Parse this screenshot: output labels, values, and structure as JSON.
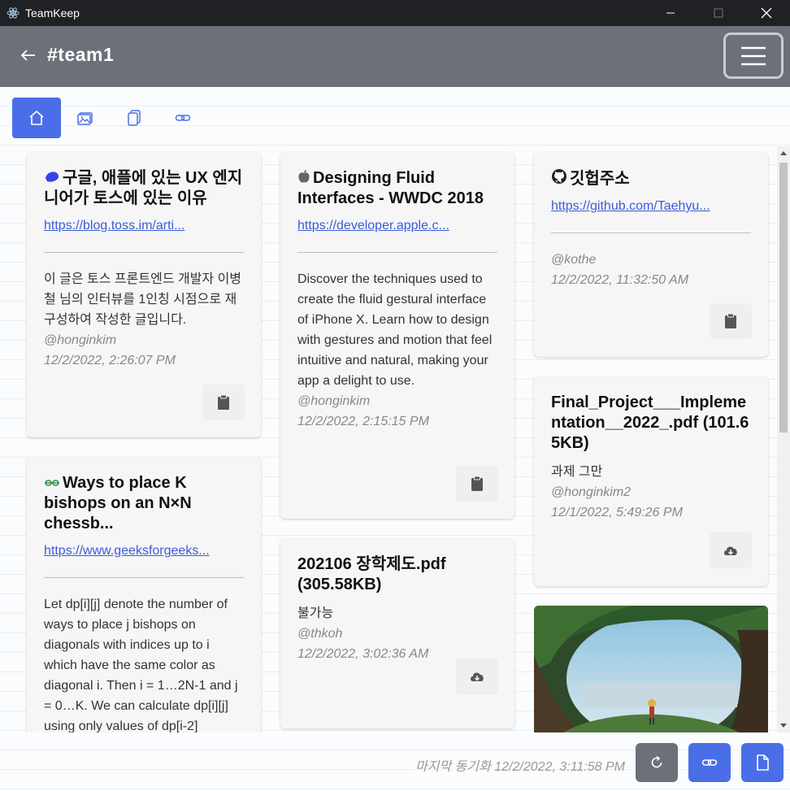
{
  "window": {
    "title": "TeamKeep"
  },
  "header": {
    "channel": "#team1"
  },
  "tabs": [
    {
      "icon": "home-icon",
      "active": true
    },
    {
      "icon": "image-icon",
      "active": false
    },
    {
      "icon": "copy-icon",
      "active": false
    },
    {
      "icon": "link-icon",
      "active": false
    }
  ],
  "cards": {
    "toss": {
      "title": "구글, 애플에 있는 UX 엔지니어가 토스에 있는 이유",
      "link": "https://blog.toss.im/arti...",
      "desc": "이 글은 토스 프론트엔드 개발자 이병철 님의 인터뷰를 1인칭 시점으로 재구성하여 작성한 글입니다.",
      "author": "@honginkim",
      "time": "12/2/2022, 2:26:07 PM"
    },
    "gfg": {
      "title": "Ways to place K bishops on an N×N chessb...",
      "link": "https://www.geeksforgeeks...",
      "desc": "Let dp[i][j] denote the number of ways to place j bishops on diagonals with indices up to i which have the same color as diagonal i. Then i = 1…2N-1 and j = 0…K. We can calculate dp[i][j] using only values of dp[i-2]"
    },
    "wwdc": {
      "title": "Designing Fluid Interfaces - WWDC 2018",
      "link": "https://developer.apple.c...",
      "desc": "Discover the techniques used to create the fluid gestural interface of iPhone X. Learn how to design with gestures and motion that feel intuitive and natural, making your app a delight to use.",
      "author": "@honginkim",
      "time": "12/2/2022, 2:15:15 PM"
    },
    "scholar": {
      "title": "202106 장학제도.pdf (305.58KB)",
      "desc": "불가능",
      "author": "@thkoh",
      "time": "12/2/2022, 3:02:36 AM"
    },
    "github": {
      "title": "깃헙주소",
      "link": "https://github.com/Taehyu...",
      "author": "@kothe",
      "time": "12/2/2022, 11:32:50 AM"
    },
    "final": {
      "title": "Final_Project___Implementation__2022_.pdf (101.65KB)",
      "desc": "과제 그만",
      "author": "@honginkim2",
      "time": "12/1/2022, 5:49:26 PM"
    }
  },
  "footer": {
    "sync": "마지막 동기화 12/2/2022, 3:11:58 PM"
  },
  "colors": {
    "accent": "#4a6ee8",
    "header": "#6b7079",
    "link": "#3b5bd9"
  }
}
